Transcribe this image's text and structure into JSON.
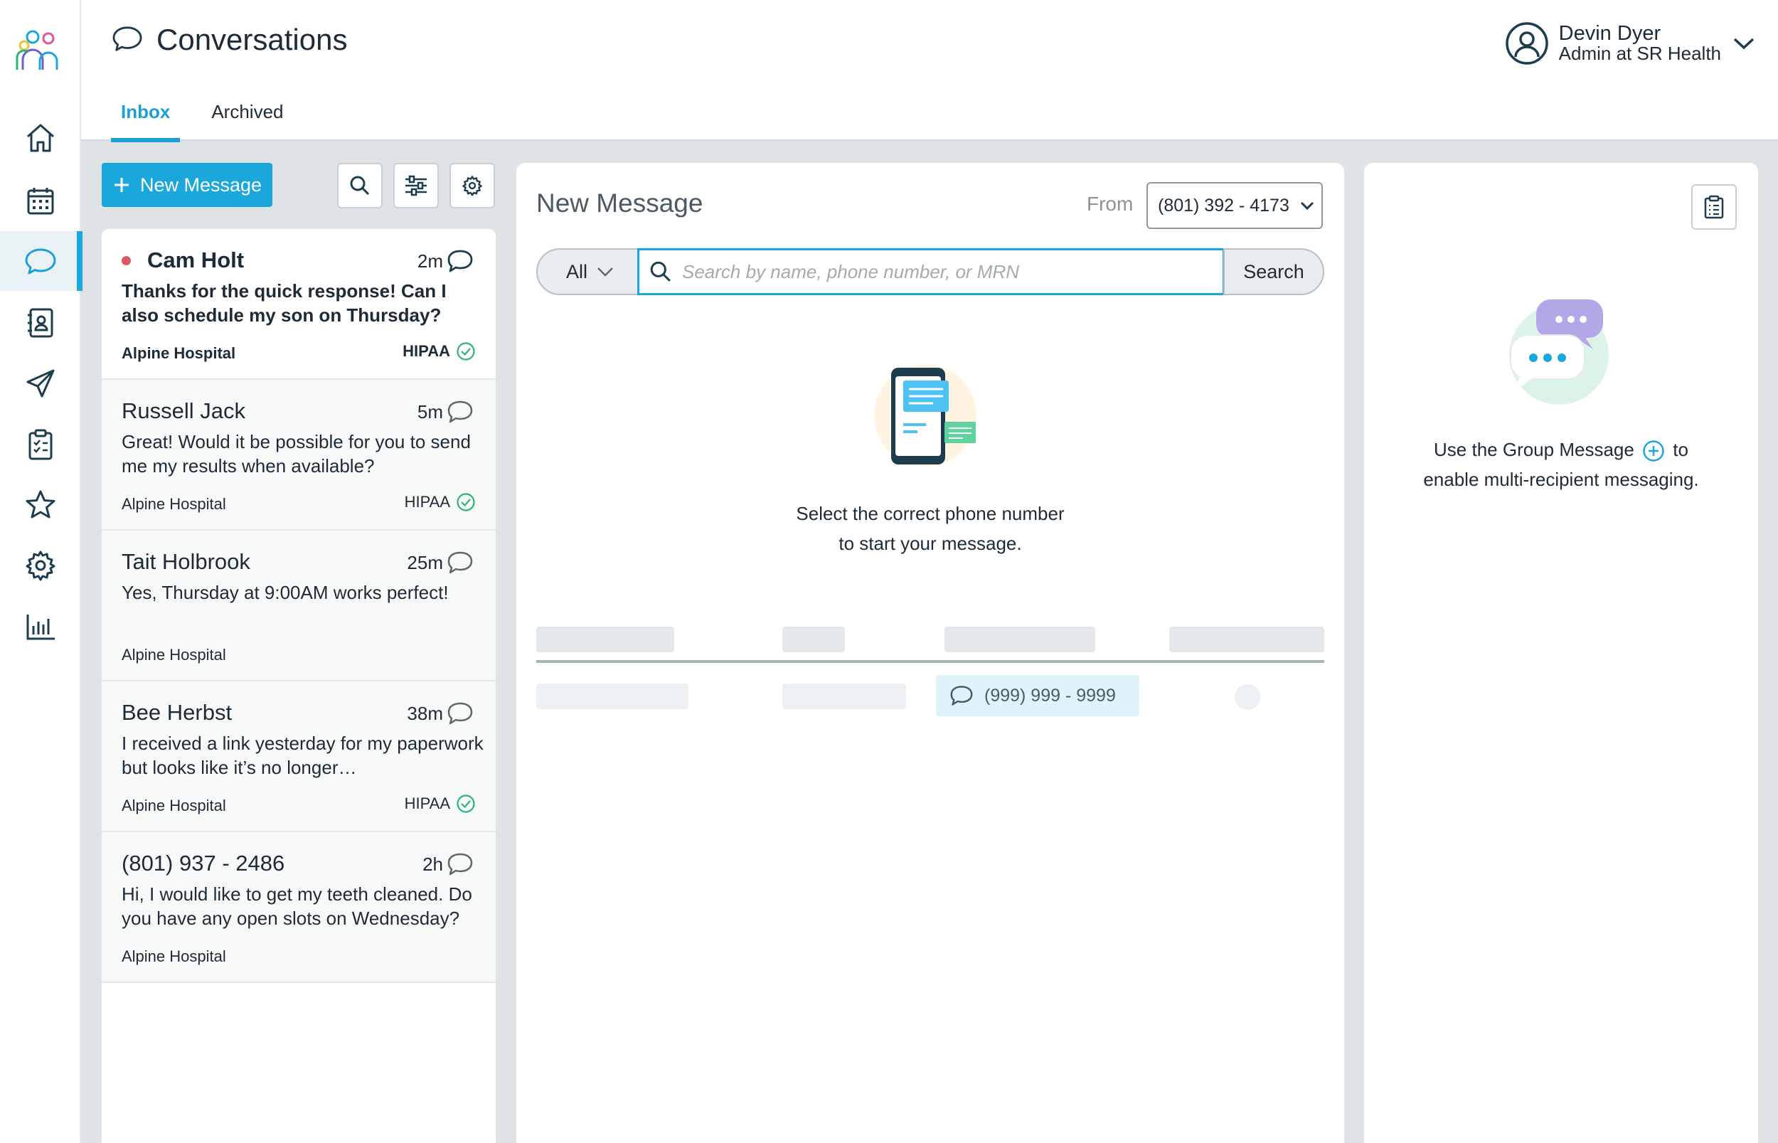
{
  "nav": {
    "items": [
      {
        "icon": "home-icon"
      },
      {
        "icon": "calendar-icon"
      },
      {
        "icon": "chat-icon",
        "active": true
      },
      {
        "icon": "contacts-icon"
      },
      {
        "icon": "send-icon"
      },
      {
        "icon": "clipboard-icon"
      },
      {
        "icon": "star-icon"
      },
      {
        "icon": "gear-icon"
      },
      {
        "icon": "chart-icon"
      }
    ]
  },
  "header": {
    "title": "Conversations",
    "tabs": [
      {
        "label": "Inbox",
        "active": true
      },
      {
        "label": "Archived",
        "active": false
      }
    ],
    "user": {
      "name": "Devin Dyer",
      "role": "Admin at SR Health"
    }
  },
  "conversations": {
    "new_message_label": "New Message",
    "items": [
      {
        "name": "Cam Holt",
        "time": "2m",
        "text": "Thanks for the quick response! Can I also schedule my son on Thursday?",
        "org": "Alpine Hospital",
        "hipaa": "HIPAA",
        "unread": true
      },
      {
        "name": "Russell Jack",
        "time": "5m",
        "text": "Great! Would it be possible for you to send me my results when available?",
        "org": "Alpine Hospital",
        "hipaa": "HIPAA",
        "unread": false
      },
      {
        "name": "Tait Holbrook",
        "time": "25m",
        "text": "Yes, Thursday at 9:00AM works perfect!",
        "org": "Alpine Hospital",
        "hipaa": "",
        "unread": false
      },
      {
        "name": "Bee Herbst",
        "time": "38m",
        "text": "I received a link yesterday for my paperwork but looks like it’s no longer…",
        "org": "Alpine Hospital",
        "hipaa": "HIPAA",
        "unread": false
      },
      {
        "name": "(801) 937 - 2486",
        "time": "2h",
        "text": "Hi, I would like to get my teeth cleaned. Do you have any open slots on Wednesday?",
        "org": "Alpine Hospital",
        "hipaa": "",
        "unread": false
      }
    ]
  },
  "new_message": {
    "title": "New Message",
    "from_label": "From",
    "from_number": "(801) 392 - 4173",
    "filter_value": "All",
    "search_placeholder": "Search by name, phone number, or MRN",
    "search_button": "Search",
    "hint_line1": "Select the correct phone number",
    "hint_line2": "to start your message.",
    "sample_phone": "(999) 999 - 9999"
  },
  "group": {
    "hint_before": "Use the Group Message",
    "hint_after": "to",
    "hint_line2": "enable multi-recipient messaging."
  },
  "colors": {
    "accent": "#1aa7dc",
    "unread": "#e05562",
    "hipaa_check": "#2bb673"
  }
}
